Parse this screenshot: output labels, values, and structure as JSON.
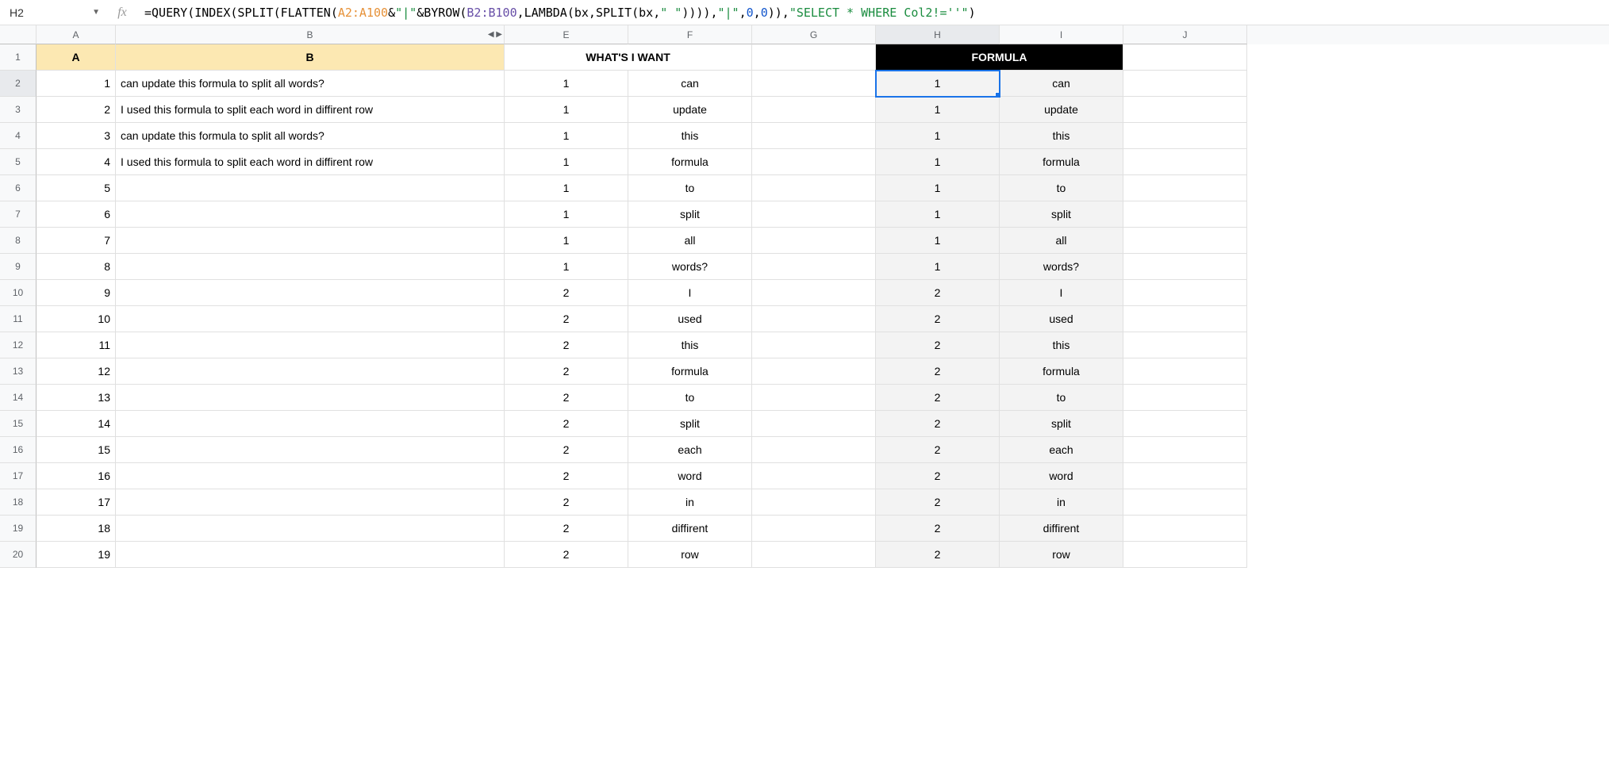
{
  "nameBox": "H2",
  "formula": {
    "parts": [
      {
        "t": "=",
        "c": "fn"
      },
      {
        "t": "QUERY",
        "c": "fn"
      },
      {
        "t": "(",
        "c": "fn"
      },
      {
        "t": "INDEX",
        "c": "fn"
      },
      {
        "t": "(",
        "c": "fn"
      },
      {
        "t": "SPLIT",
        "c": "fn"
      },
      {
        "t": "(",
        "c": "fn"
      },
      {
        "t": "FLATTEN",
        "c": "fn"
      },
      {
        "t": "(",
        "c": "fn"
      },
      {
        "t": "A2:A100",
        "c": "range1"
      },
      {
        "t": "&",
        "c": "fn"
      },
      {
        "t": "\"|\"",
        "c": "str"
      },
      {
        "t": "&",
        "c": "fn"
      },
      {
        "t": "BYROW",
        "c": "fn"
      },
      {
        "t": "(",
        "c": "fn"
      },
      {
        "t": "B2:B100",
        "c": "range3"
      },
      {
        "t": ",",
        "c": "fn"
      },
      {
        "t": "LAMBDA",
        "c": "fn"
      },
      {
        "t": "(bx,",
        "c": "fn"
      },
      {
        "t": "SPLIT",
        "c": "fn"
      },
      {
        "t": "(bx,",
        "c": "fn"
      },
      {
        "t": "\" \"",
        "c": "str"
      },
      {
        "t": ")))),",
        "c": "fn"
      },
      {
        "t": "\"|\"",
        "c": "str"
      },
      {
        "t": ",",
        "c": "fn"
      },
      {
        "t": "0",
        "c": "num"
      },
      {
        "t": ",",
        "c": "fn"
      },
      {
        "t": "0",
        "c": "num"
      },
      {
        "t": ")),",
        "c": "fn"
      },
      {
        "t": "\"SELECT * WHERE Col2!=''\"",
        "c": "str"
      },
      {
        "t": ")",
        "c": "fn"
      }
    ]
  },
  "columns": [
    "A",
    "B",
    "E",
    "F",
    "G",
    "H",
    "I",
    "J"
  ],
  "headerRow": {
    "A": "A",
    "B": "B",
    "EF": "WHAT'S I WANT",
    "HI": "FORMULA"
  },
  "rows": [
    {
      "n": "1"
    },
    {
      "n": "2",
      "A": "1",
      "B": "can update this formula to split all words?",
      "E": "1",
      "F": "can",
      "H": "1",
      "I": "can"
    },
    {
      "n": "3",
      "A": "2",
      "B": "I used this formula to split each word in diffirent row",
      "E": "1",
      "F": "update",
      "H": "1",
      "I": "update"
    },
    {
      "n": "4",
      "A": "3",
      "B": "can update this formula to split all words?",
      "E": "1",
      "F": "this",
      "H": "1",
      "I": "this"
    },
    {
      "n": "5",
      "A": "4",
      "B": "I used this formula to split each word in diffirent row",
      "E": "1",
      "F": "formula",
      "H": "1",
      "I": "formula"
    },
    {
      "n": "6",
      "A": "5",
      "B": "",
      "E": "1",
      "F": "to",
      "H": "1",
      "I": "to"
    },
    {
      "n": "7",
      "A": "6",
      "B": "",
      "E": "1",
      "F": "split",
      "H": "1",
      "I": "split"
    },
    {
      "n": "8",
      "A": "7",
      "B": "",
      "E": "1",
      "F": "all",
      "H": "1",
      "I": "all"
    },
    {
      "n": "9",
      "A": "8",
      "B": "",
      "E": "1",
      "F": "words?",
      "H": "1",
      "I": "words?"
    },
    {
      "n": "10",
      "A": "9",
      "B": "",
      "E": "2",
      "F": "I",
      "H": "2",
      "I": "I"
    },
    {
      "n": "11",
      "A": "10",
      "B": "",
      "E": "2",
      "F": "used",
      "H": "2",
      "I": "used"
    },
    {
      "n": "12",
      "A": "11",
      "B": "",
      "E": "2",
      "F": "this",
      "H": "2",
      "I": "this"
    },
    {
      "n": "13",
      "A": "12",
      "B": "",
      "E": "2",
      "F": "formula",
      "H": "2",
      "I": "formula"
    },
    {
      "n": "14",
      "A": "13",
      "B": "",
      "E": "2",
      "F": "to",
      "H": "2",
      "I": "to"
    },
    {
      "n": "15",
      "A": "14",
      "B": "",
      "E": "2",
      "F": "split",
      "H": "2",
      "I": "split"
    },
    {
      "n": "16",
      "A": "15",
      "B": "",
      "E": "2",
      "F": "each",
      "H": "2",
      "I": "each"
    },
    {
      "n": "17",
      "A": "16",
      "B": "",
      "E": "2",
      "F": "word",
      "H": "2",
      "I": "word"
    },
    {
      "n": "18",
      "A": "17",
      "B": "",
      "E": "2",
      "F": "in",
      "H": "2",
      "I": "in"
    },
    {
      "n": "19",
      "A": "18",
      "B": "",
      "E": "2",
      "F": "diffirent",
      "H": "2",
      "I": "diffirent"
    },
    {
      "n": "20",
      "A": "19",
      "B": "",
      "E": "2",
      "F": "row",
      "H": "2",
      "I": "row"
    }
  ],
  "selectedCell": "H2"
}
